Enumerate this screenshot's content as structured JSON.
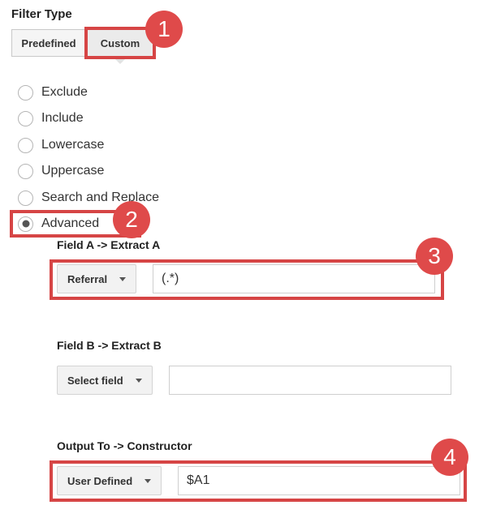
{
  "filter_type": {
    "title": "Filter Type",
    "tabs": {
      "predefined": "Predefined",
      "custom": "Custom"
    },
    "selected_tab": "Custom"
  },
  "options": [
    {
      "label": "Exclude",
      "checked": false
    },
    {
      "label": "Include",
      "checked": false
    },
    {
      "label": "Lowercase",
      "checked": false
    },
    {
      "label": "Uppercase",
      "checked": false
    },
    {
      "label": "Search and Replace",
      "checked": false
    },
    {
      "label": "Advanced",
      "checked": true
    }
  ],
  "field_a": {
    "label": "Field A -> Extract A",
    "select_value": "Referral",
    "input_value": "(.*)"
  },
  "field_b": {
    "label": "Field B -> Extract B",
    "select_value": "Select field",
    "input_value": ""
  },
  "output": {
    "label": "Output To -> Constructor",
    "select_value": "User Defined",
    "input_value": "$A1"
  },
  "annotations": [
    "1",
    "2",
    "3",
    "4"
  ],
  "colors": {
    "highlight": "#d64545",
    "badge": "#df4a4a"
  }
}
